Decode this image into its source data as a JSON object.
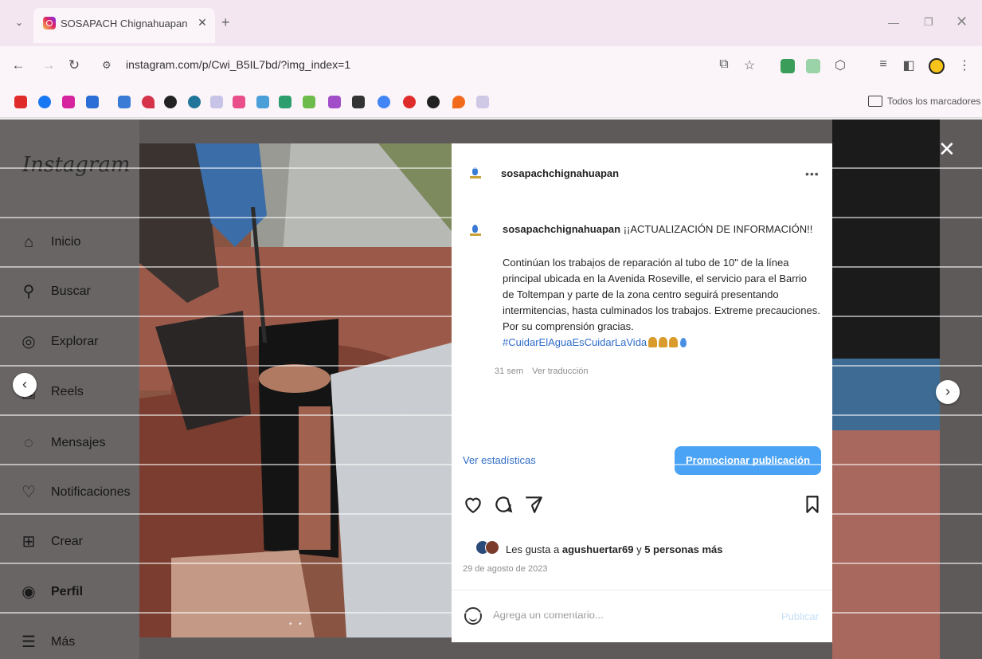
{
  "browser": {
    "tab_title": "SOSAPACH Chignahuapan (@",
    "url": "instagram.com/p/Cwi_B5IL7bd/?img_index=1",
    "all_bookmarks_label": "Todos los marcadores",
    "accent_color": "#f3e6f0"
  },
  "instagram": {
    "logo_text": "Instagram",
    "nav": [
      {
        "label": "Inicio",
        "icon": "home-icon"
      },
      {
        "label": "Buscar",
        "icon": "search-icon"
      },
      {
        "label": "Explorar",
        "icon": "compass-icon"
      },
      {
        "label": "Reels",
        "icon": "reels-icon"
      },
      {
        "label": "Mensajes",
        "icon": "messenger-icon"
      },
      {
        "label": "Notificaciones",
        "icon": "heart-icon"
      },
      {
        "label": "Crear",
        "icon": "plus-square-icon"
      },
      {
        "label": "Perfil",
        "icon": "profile-icon"
      },
      {
        "label": "Más",
        "icon": "menu-icon"
      }
    ]
  },
  "post": {
    "username": "sosapachchignahuapan",
    "caption_headline": "¡¡ACTUALIZACIÓN DE INFORMACIÓN!!",
    "caption_body": "Continúan los trabajos de reparación al tubo de 10\" de la línea principal ubicada en la Avenida Roseville, el servicio para el Barrio de Toltempan y parte de la zona centro seguirá presentando intermitencias, hasta culminados los trabajos. Extreme precauciones. Por su comprensión gracias.",
    "hashtag": "#CuidarElAguaEsCuidarLaVida",
    "time_ago": "31 sem",
    "translate_label": "Ver traducción",
    "stats_link": "Ver estadísticas",
    "promote_button": "Promocionar publicación",
    "likes_prefix": "Les gusta a",
    "likes_user": "agushuertar69",
    "likes_joiner": "y",
    "likes_others": "5 personas más",
    "date": "29 de agosto de 2023",
    "comment_placeholder": "Agrega un comentario...",
    "publish_label": "Publicar",
    "promote_color": "#4aa3f5"
  }
}
